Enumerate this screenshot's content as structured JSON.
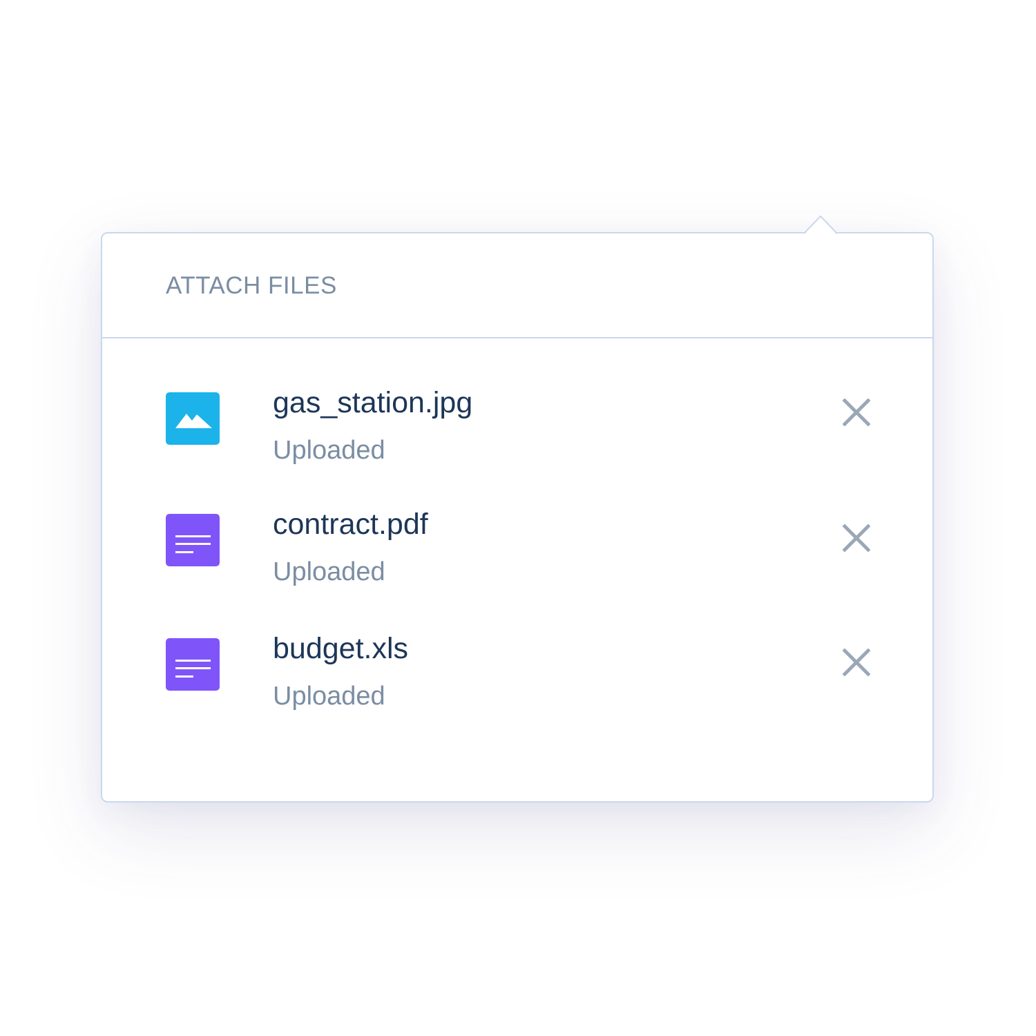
{
  "popover": {
    "title": "ATTACH FILES"
  },
  "files": [
    {
      "name": "gas_station.jpg",
      "status": "Uploaded",
      "icon": "image-file-icon",
      "icon_color": "#1bb3ea"
    },
    {
      "name": "contract.pdf",
      "status": "Uploaded",
      "icon": "document-file-icon",
      "icon_color": "#7f55f9"
    },
    {
      "name": "budget.xls",
      "status": "Uploaded",
      "icon": "document-file-icon",
      "icon_color": "#7f55f9"
    }
  ],
  "colors": {
    "title_text": "#7b8da3",
    "file_name_text": "#1d3658",
    "status_text": "#7b8da3",
    "border": "#c9d8ee",
    "remove_icon": "#9aa7b6"
  }
}
